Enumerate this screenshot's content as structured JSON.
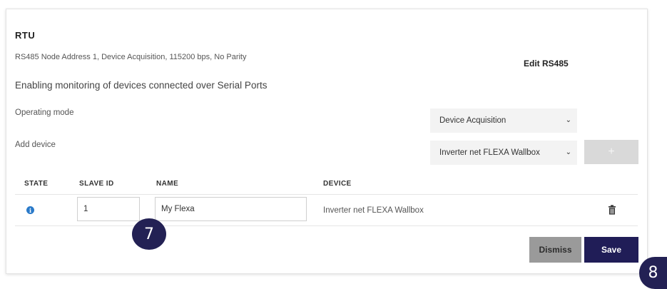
{
  "section": {
    "title": "RTU",
    "summary": "RS485 Node Address 1, Device Acquisition, 115200 bps, No Parity",
    "edit_link": "Edit RS485",
    "description": "Enabling monitoring of devices connected over Serial Ports"
  },
  "form": {
    "operating_mode_label": "Operating mode",
    "operating_mode_value": "Device Acquisition",
    "add_device_label": "Add device",
    "add_device_value": "Inverter net FLEXA Wallbox",
    "add_button": "+"
  },
  "table": {
    "headers": [
      "STATE",
      "SLAVE ID",
      "NAME",
      "DEVICE"
    ],
    "rows": [
      {
        "state_icon": "info-icon",
        "slave_id": "1",
        "name": "My Flexa",
        "device": "Inverter net FLEXA Wallbox",
        "action_icon": "trash-icon"
      }
    ]
  },
  "actions": {
    "dismiss": "Dismiss",
    "save": "Save"
  },
  "callouts": [
    "7",
    "8"
  ],
  "colors": {
    "primary": "#201d57",
    "dismiss": "#9a9a9a",
    "info": "#2a7ac9",
    "select_bg": "#f3f3f3"
  }
}
